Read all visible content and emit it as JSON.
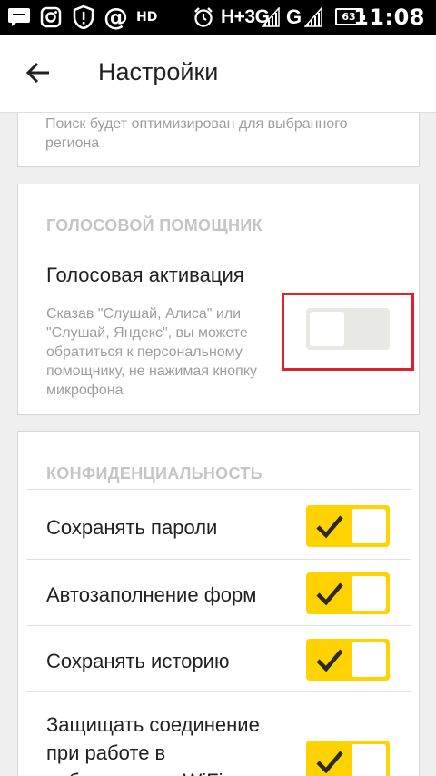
{
  "status_bar": {
    "time": "11:08",
    "battery": "63",
    "network_1": "H+3G",
    "network_2": "G",
    "hd_label": "HD"
  },
  "app_bar": {
    "title": "Настройки"
  },
  "region_card": {
    "description": "Поиск будет оптимизирован для выбранного региона"
  },
  "voice_section": {
    "header": "ГОЛОСОВОЙ ПОМОЩНИК",
    "item": {
      "title": "Голосовая активация",
      "description": "Сказав \"Слушай, Алиса\" или \"Слушай, Яндекс\", вы можете обратиться к персональному помощнику, не нажимая кнопку микрофона",
      "enabled": false
    }
  },
  "privacy_section": {
    "header": "КОНФИДЕНЦИАЛЬНОСТЬ",
    "items": [
      {
        "title": "Сохранять пароли",
        "enabled": true
      },
      {
        "title": "Автозаполнение форм",
        "enabled": true
      },
      {
        "title": "Сохранять историю",
        "enabled": true
      },
      {
        "title": "Защищать соединение при работе в небезопасных WiFi",
        "enabled": true
      }
    ]
  },
  "colors": {
    "accent": "#ffd200",
    "highlight": "#e0202a"
  }
}
